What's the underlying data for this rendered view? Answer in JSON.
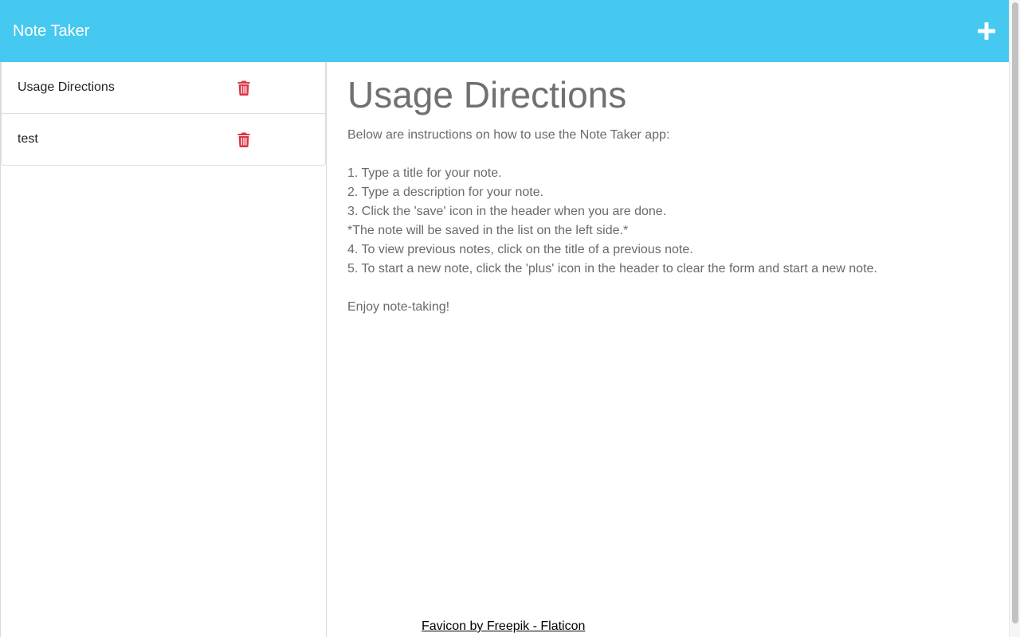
{
  "header": {
    "title": "Note Taker",
    "new_note_icon": "plus-icon",
    "background": "#46c9f0"
  },
  "sidebar": {
    "notes": [
      {
        "title": "Usage Directions",
        "delete_icon": "trash-icon"
      },
      {
        "title": "test",
        "delete_icon": "trash-icon"
      }
    ],
    "delete_color": "#dc3545"
  },
  "note": {
    "title": "Usage Directions",
    "lines": [
      "Below are instructions on how to use the Note Taker app:",
      "",
      "1. Type a title for your note.",
      "2. Type a description for your note.",
      "3. Click the 'save' icon in the header when you are done.",
      "*The note will be saved in the list on the left side.*",
      "4. To view previous notes, click on the title of a previous note.",
      "5. To start a new note, click the 'plus' icon in the header to clear the form and start a new note.",
      "",
      "Enjoy note-taking!"
    ]
  },
  "footer": {
    "credit": "Favicon by Freepik - Flaticon"
  }
}
